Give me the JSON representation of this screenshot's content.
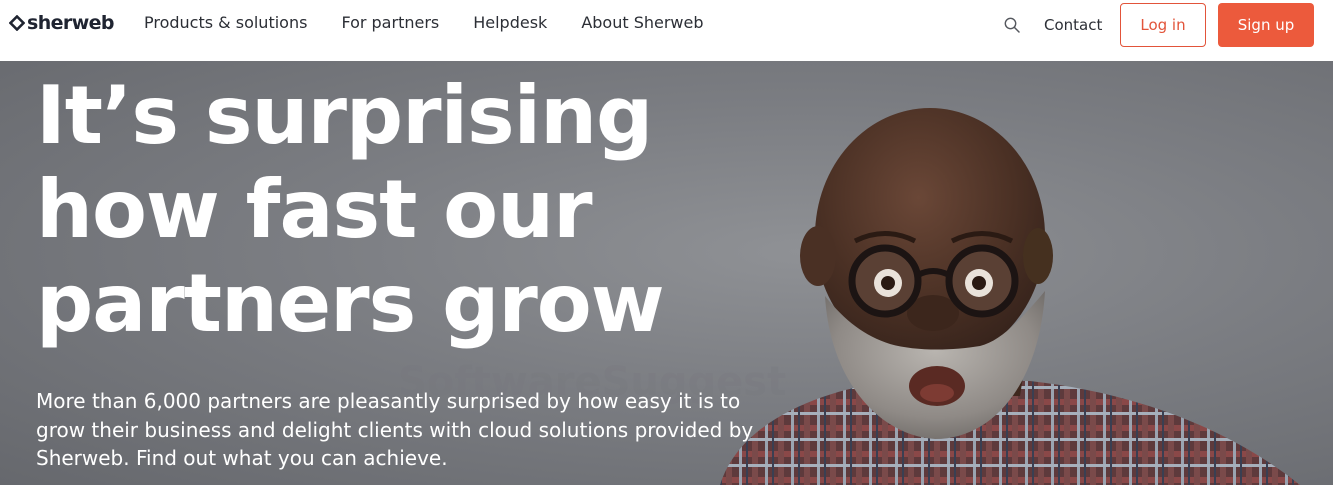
{
  "brand": {
    "name": "sherweb",
    "accent_color": "#ec5a3c",
    "dark_color": "#1f2431"
  },
  "nav": {
    "items": [
      {
        "label": "Products & solutions"
      },
      {
        "label": "For partners"
      },
      {
        "label": "Helpdesk"
      },
      {
        "label": "About Sherweb"
      }
    ],
    "search_icon": "search-icon",
    "contact": "Contact",
    "login": "Log in",
    "signup": "Sign up"
  },
  "hero": {
    "headline": [
      "It’s surprising",
      "how fast our",
      "partners grow"
    ],
    "subtext": "More than 6,000 partners are pleasantly surprised by how easy it is to grow their business and delight clients with cloud solutions provided by Sherweb. Find out what you can achieve.",
    "watermark": "SoftwareSuggest"
  }
}
